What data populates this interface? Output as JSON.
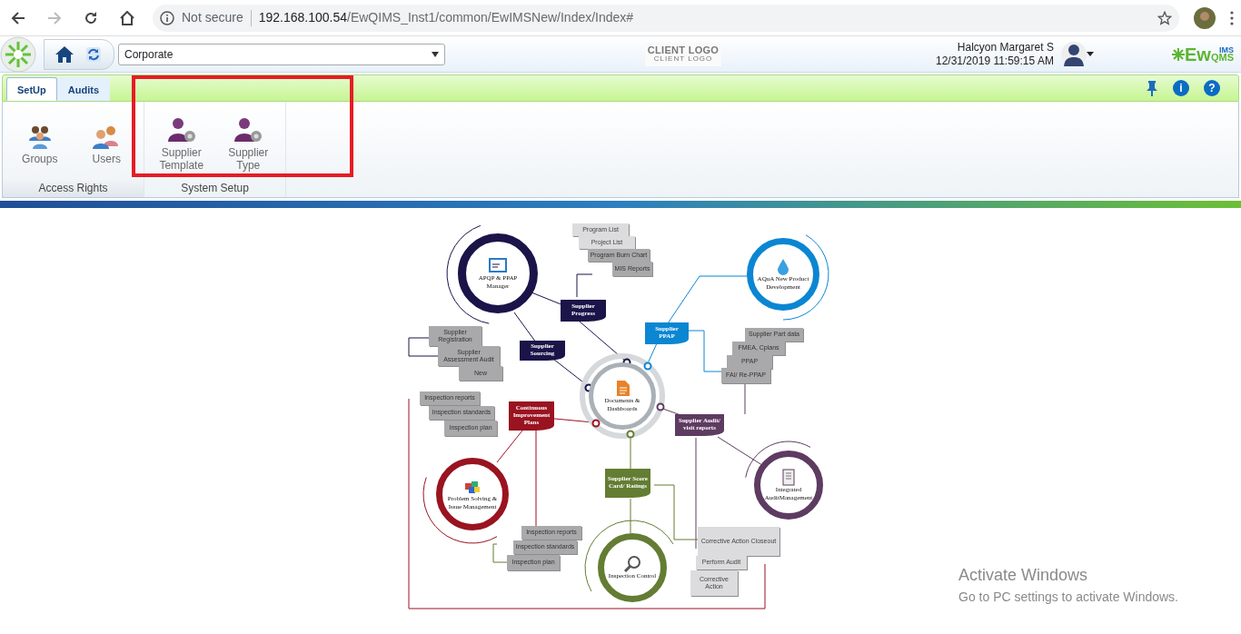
{
  "browser": {
    "security": "Not secure",
    "url_host": "192.168.100.54",
    "url_path": "/EwQIMS_Inst1/common/EwIMSNew/Index/Index#"
  },
  "header": {
    "site_select": "Corporate",
    "client_logo": "CLIENT LOGO",
    "client_logo_sub": "CLIENT LOGO",
    "user_name": "Halcyon Margaret S",
    "datetime": "12/31/2019 11:59:15 AM",
    "brand_main": "Ew",
    "brand_top": "IMS",
    "brand_bottom": "QMS"
  },
  "ribbon": {
    "tabs": [
      {
        "label": "SetUp",
        "selected": true
      },
      {
        "label": "Audits",
        "selected": false
      }
    ],
    "tool_icons": [
      "i",
      "?"
    ],
    "groups": [
      {
        "label": "Access Rights",
        "items": [
          {
            "label": "Groups",
            "kind": "group"
          },
          {
            "label": "Users",
            "kind": "users"
          }
        ]
      },
      {
        "label": "System Setup",
        "items": [
          {
            "label": "Supplier Template",
            "kind": "supplier"
          },
          {
            "label": "Supplier Type",
            "kind": "supplier"
          }
        ]
      }
    ]
  },
  "diagram": {
    "hub": {
      "label": "Documents & Dashboards"
    },
    "modules": [
      {
        "label": "APQP & PPAP Manager",
        "color": "#1b1449"
      },
      {
        "label": "AQuA New Product Development",
        "color": "#0b86d2"
      },
      {
        "label": "Problem Solving & Issue Management",
        "color": "#9a1320"
      },
      {
        "label": "Inspection Control",
        "color": "#637d33"
      },
      {
        "label": "Integrated AuditManagement",
        "color": "#5e3b61"
      }
    ],
    "flags": [
      {
        "label": "Supplier Progress",
        "color": "#1b1449"
      },
      {
        "label": "Supplier Sourcing",
        "color": "#1b1449"
      },
      {
        "label": "Supplier PPAP",
        "color": "#0b86d2"
      },
      {
        "label": "Continuous Improvement Plans",
        "color": "#9a1320"
      },
      {
        "label": "Supplier Audit/ visit reports",
        "color": "#5e3b61"
      },
      {
        "label": "Supplier Score Card/ Ratings",
        "color": "#637d33"
      }
    ],
    "lists": [
      {
        "items": [
          "Program List",
          "Project List",
          "Program Burn Chart",
          "MIS Reports"
        ]
      },
      {
        "items": [
          "Supplier Registration",
          "Supplier Assessment Audit",
          "New"
        ]
      },
      {
        "items": [
          "Inspection reports",
          "Inspection standards",
          "Inspection plan"
        ]
      },
      {
        "items": [
          "Supplier Part data",
          "FMEA, Cplans",
          "PPAP",
          "FAI/ Re-PPAP"
        ]
      },
      {
        "items": [
          "Inspection reports",
          "Inspection standards",
          "Inspection plan"
        ]
      },
      {
        "items": [
          "Corrective Action Closeout",
          "Perform Audit",
          "Corrective Action"
        ]
      }
    ]
  },
  "windows_notice": {
    "title": "Activate Windows",
    "subtitle": "Go to PC settings to activate Windows."
  }
}
